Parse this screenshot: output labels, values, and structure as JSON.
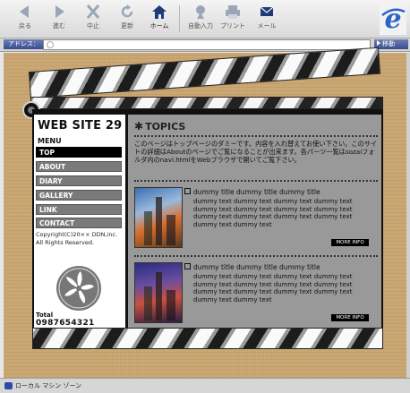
{
  "toolbar": {
    "buttons": [
      {
        "label": "戻る",
        "icon": "back-arrow-icon"
      },
      {
        "label": "進む",
        "icon": "forward-arrow-icon"
      },
      {
        "label": "中止",
        "icon": "stop-icon"
      },
      {
        "label": "更新",
        "icon": "refresh-icon"
      },
      {
        "label": "ホーム",
        "icon": "home-icon"
      },
      {
        "label": "自動入力",
        "icon": "autofill-icon"
      },
      {
        "label": "プリント",
        "icon": "print-icon"
      },
      {
        "label": "メール",
        "icon": "mail-icon"
      }
    ]
  },
  "address": {
    "label": "アドレス：",
    "value": "",
    "go": "移動"
  },
  "status": {
    "text": "ローカル マシン ゾーン"
  },
  "site": {
    "title": "WEB SITE 29",
    "menu_title": "MENU",
    "menu": [
      "TOP",
      "ABOUT",
      "DIARY",
      "GALLERY",
      "LINK",
      "CONTACT"
    ],
    "active_menu": "TOP",
    "copyright": "Copyright(C)20×× DDN,inc. All Rights Reserved.",
    "total_label": "Total",
    "total_value": "0987654321"
  },
  "topics": {
    "heading": "TOPICS",
    "intro": "このページはトップページのダミーです。内容を入れ替えてお使い下さい。このサイトの詳細はAboutのページでご覧になることが出来ます。各パーツ一覧はsozaiフォルダ内のnavi.htmlをWebブラウザで開いてご覧下さい。",
    "items": [
      {
        "title": "dummy title dummy title dummy title",
        "text": "dummy text dummy text dummy text dummy text dummy text dummy text dummy text dummy text dummy text dummy text dummy text dummy text dummy text dummy text",
        "more": "MORE INFO"
      },
      {
        "title": "dummy title dummy title dummy title",
        "text": "dummy text dummy text dummy text dummy text dummy text dummy text dummy text dummy text dummy text dummy text dummy text dummy text dummy text dummy text",
        "more": "MORE INFO"
      }
    ]
  }
}
